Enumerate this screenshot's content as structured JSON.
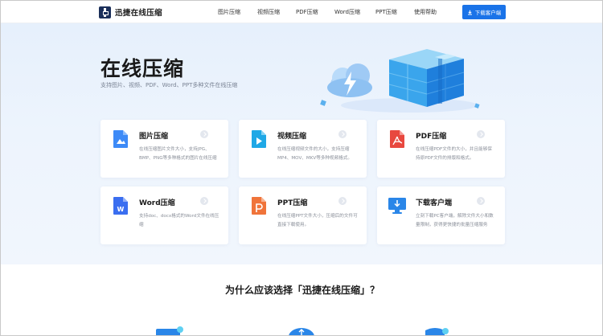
{
  "header": {
    "logo_text": "迅捷在线压缩",
    "nav": [
      "图片压缩",
      "视频压缩",
      "PDF压缩",
      "Word压缩",
      "PPT压缩",
      "使用帮助"
    ],
    "download_label": "下载客户端"
  },
  "hero": {
    "title": "在线压缩",
    "subtitle": "支持图片、视频、PDF、Word、PPT多种文件在线压缩"
  },
  "cards": [
    {
      "title": "图片压缩",
      "desc": "在线压缩图片文件大小，支持JPG、BMP、PNG等多种格式的图片在线压缩",
      "icon": "image-icon",
      "color": "#3d8af7"
    },
    {
      "title": "视频压缩",
      "desc": "在线压缩视频文件的大小，支持压缩MP4、MOV、MKV等多种视频格式。",
      "icon": "video-icon",
      "color": "#1fa8e6"
    },
    {
      "title": "PDF压缩",
      "desc": "在线压缩PDF文件的大小，并且能够保持原PDF文件的排版和格式。",
      "icon": "pdf-icon",
      "color": "#e8483f"
    },
    {
      "title": "Word压缩",
      "desc": "支持doc、docx格式的Word文件在线压缩",
      "icon": "word-icon",
      "color": "#3a6ef0"
    },
    {
      "title": "PPT压缩",
      "desc": "在线压缩PPT文件大小，压缩后的文件可直接下载使用。",
      "icon": "ppt-icon",
      "color": "#f0743a"
    },
    {
      "title": "下载客户端",
      "desc": "立刻下载PC客户端，解除文件大小和数量限制，获得更快捷的批量压缩服务",
      "icon": "monitor-download-icon",
      "color": "#2a86e8"
    }
  ],
  "why_title": "为什么应该选择「迅捷在线压缩」？"
}
